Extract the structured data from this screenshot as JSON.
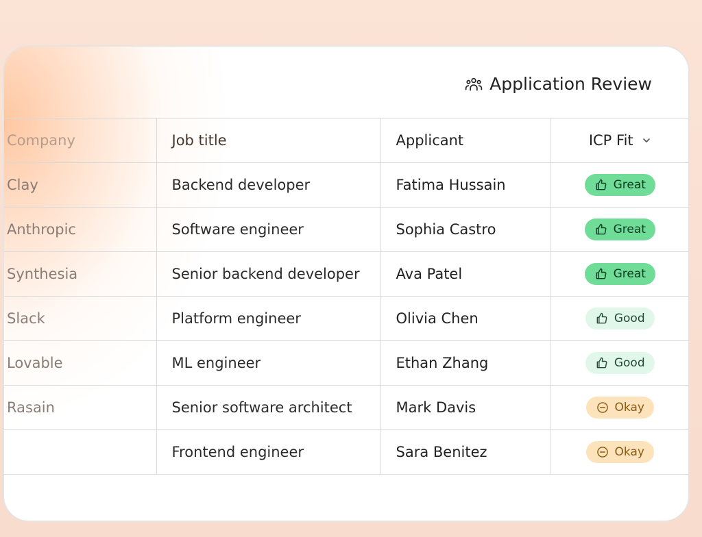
{
  "header": {
    "title": "Application Review",
    "icon": "users-icon"
  },
  "table": {
    "columns": [
      "Company",
      "Job title",
      "Applicant",
      "ICP Fit"
    ],
    "rows": [
      {
        "company": "Clay",
        "job_title": "Backend developer",
        "applicant": "Fatima Hussain",
        "fit": "Great"
      },
      {
        "company": "Anthropic",
        "job_title": "Software engineer",
        "applicant": "Sophia Castro",
        "fit": "Great"
      },
      {
        "company": "Synthesia",
        "job_title": "Senior backend developer",
        "applicant": "Ava Patel",
        "fit": "Great"
      },
      {
        "company": "Slack",
        "job_title": "Platform engineer",
        "applicant": "Olivia Chen",
        "fit": "Good"
      },
      {
        "company": "Lovable",
        "job_title": "ML engineer",
        "applicant": "Ethan Zhang",
        "fit": "Good"
      },
      {
        "company": "Rasain",
        "job_title": "Senior software architect",
        "applicant": "Mark Davis",
        "fit": "Okay"
      },
      {
        "company": "",
        "job_title": "Frontend engineer",
        "applicant": "Sara Benitez",
        "fit": "Okay"
      }
    ]
  },
  "colors": {
    "great": "#6fdc97",
    "good": "#e0f7ea",
    "okay": "#fde3bb"
  }
}
